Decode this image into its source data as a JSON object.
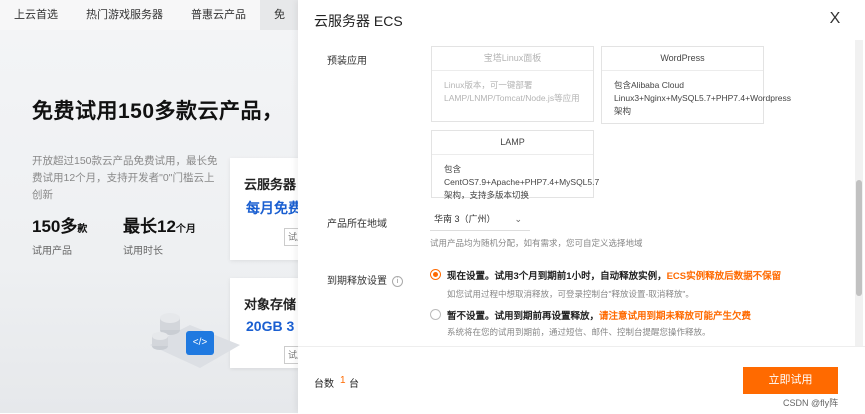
{
  "background": {
    "nav": [
      "上云首选",
      "热门游戏服务器",
      "普惠云产品",
      "免"
    ],
    "hero_title": "免费试用150多款云产品，",
    "hero_desc": "开放超过150款云产品免费试用，最长免费试用12个月，支持开发者\"0\"门槛云上创新",
    "stats": [
      {
        "num": "150多",
        "unit": "款",
        "label": "试用产品"
      },
      {
        "num": "最长12",
        "unit": "个月",
        "label": "试用时长"
      }
    ],
    "card1": {
      "title": "云服务器",
      "subtitle": "每月免费",
      "btn": "试用"
    },
    "card2": {
      "title": "对象存储",
      "subtitle": "20GB 3",
      "btn": "试用"
    },
    "badge": "</>"
  },
  "drawer": {
    "title": "云服务器 ECS",
    "close": "X",
    "preinstall_label": "预装应用",
    "apps": [
      {
        "name": "宝塔Linux面板",
        "desc": "Linux版本，可一键部署LAMP/LNMP/Tomcat/Node.js等应用"
      },
      {
        "name": "WordPress",
        "desc": "包含Alibaba Cloud Linux3+Nginx+MySQL5.7+PHP7.4+Wordpress架构"
      },
      {
        "name": "LAMP",
        "desc": "包含CentOS7.9+Apache+PHP7.4+MySQL5.7架构，支持多版本切换"
      }
    ],
    "region_label": "产品所在地域",
    "region_value": "华南 3（广州）",
    "region_hint": "试用产品均为随机分配，如有需求，您可自定义选择地域",
    "expire_label": "到期释放设置",
    "option1": {
      "main": "现在设置。试用3个月到期前1小时，自动释放实例，",
      "warn": "ECS实例释放后数据不保留"
    },
    "option1_hint": "如您试用过程中想取消释放，可登录控制台\"释放设置-取消释放\"。",
    "option2": {
      "main": "暂不设置。试用到期前再设置释放，",
      "warn": "请注意试用到期未释放可能产生欠费"
    },
    "option2_hint": "系统将在您的试用到期前，通过短信、邮件、控制台提醒您操作释放。",
    "qty_label": "台数",
    "qty_value": "1",
    "qty_unit": "台",
    "submit": "立即试用"
  },
  "watermark": "CSDN @fly阵",
  "colors": {
    "accent": "#ff6a00",
    "blue": "#1a5fd1"
  }
}
